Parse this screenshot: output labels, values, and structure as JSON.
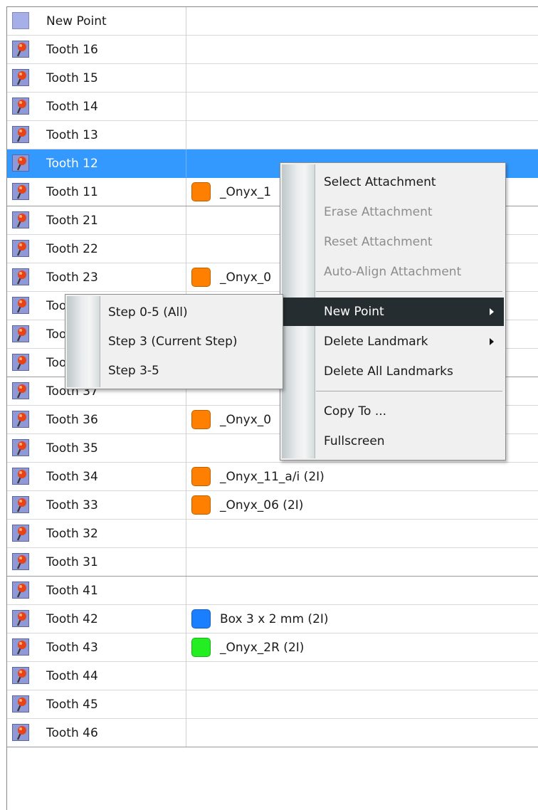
{
  "list": {
    "rows": [
      {
        "name": "New Point",
        "icon": "new-point-icon"
      },
      {
        "name": "Tooth 16",
        "icon": "tooth-pin-icon"
      },
      {
        "name": "Tooth 15",
        "icon": "tooth-pin-icon"
      },
      {
        "name": "Tooth 14",
        "icon": "tooth-pin-icon"
      },
      {
        "name": "Tooth 13",
        "icon": "tooth-pin-icon"
      },
      {
        "name": "Tooth 12",
        "icon": "tooth-pin-icon",
        "selected": true
      },
      {
        "name": "Tooth 11",
        "icon": "tooth-pin-icon",
        "attachment": "_Onyx_1",
        "color": "#ff8000"
      },
      {
        "name": "Tooth 21",
        "icon": "tooth-pin-icon"
      },
      {
        "name": "Tooth 22",
        "icon": "tooth-pin-icon"
      },
      {
        "name": "Tooth 23",
        "icon": "tooth-pin-icon",
        "attachment": "_Onyx_0",
        "color": "#ff8000"
      },
      {
        "name": "Too",
        "icon": "tooth-pin-icon"
      },
      {
        "name": "Too",
        "icon": "tooth-pin-icon"
      },
      {
        "name": "Too",
        "icon": "tooth-pin-icon"
      },
      {
        "name": "Tooth 37",
        "icon": "tooth-pin-icon"
      },
      {
        "name": "Tooth 36",
        "icon": "tooth-pin-icon",
        "attachment": "_Onyx_0",
        "color": "#ff8000"
      },
      {
        "name": "Tooth 35",
        "icon": "tooth-pin-icon"
      },
      {
        "name": "Tooth 34",
        "icon": "tooth-pin-icon",
        "attachment": "_Onyx_11_a/i (2I)",
        "color": "#ff8000"
      },
      {
        "name": "Tooth 33",
        "icon": "tooth-pin-icon",
        "attachment": "_Onyx_06 (2I)",
        "color": "#ff8000"
      },
      {
        "name": "Tooth 32",
        "icon": "tooth-pin-icon"
      },
      {
        "name": "Tooth 31",
        "icon": "tooth-pin-icon"
      },
      {
        "name": "Tooth 41",
        "icon": "tooth-pin-icon"
      },
      {
        "name": "Tooth 42",
        "icon": "tooth-pin-icon",
        "attachment": "Box 3 x 2 mm (2I)",
        "color": "#1a7fff"
      },
      {
        "name": "Tooth 43",
        "icon": "tooth-pin-icon",
        "attachment": "_Onyx_2R (2I)",
        "color": "#22ee22"
      },
      {
        "name": "Tooth 44",
        "icon": "tooth-pin-icon"
      },
      {
        "name": "Tooth 45",
        "icon": "tooth-pin-icon"
      },
      {
        "name": "Tooth 46",
        "icon": "tooth-pin-icon"
      }
    ]
  },
  "context_menu": {
    "items": [
      {
        "label": "Select Attachment",
        "enabled": true
      },
      {
        "label": "Erase Attachment",
        "enabled": false
      },
      {
        "label": "Reset Attachment",
        "enabled": false
      },
      {
        "label": "Auto-Align Attachment",
        "enabled": false
      },
      {
        "label": "New Point",
        "enabled": true,
        "submenu": true,
        "highlighted": true
      },
      {
        "label": "Delete Landmark",
        "enabled": true,
        "submenu": true
      },
      {
        "label": "Delete All Landmarks",
        "enabled": true
      },
      {
        "label": "Copy To ...",
        "enabled": true
      },
      {
        "label": "Fullscreen",
        "enabled": true
      }
    ]
  },
  "submenu": {
    "items": [
      {
        "label": "Step 0-5 (All)"
      },
      {
        "label": "Step 3 (Current Step)"
      },
      {
        "label": "Step 3-5"
      }
    ]
  },
  "colors": {
    "selection": "#3399ff",
    "menu_highlight": "#262d31",
    "attachment_orange": "#ff8000",
    "attachment_blue": "#1a7fff",
    "attachment_green": "#22ee22"
  }
}
